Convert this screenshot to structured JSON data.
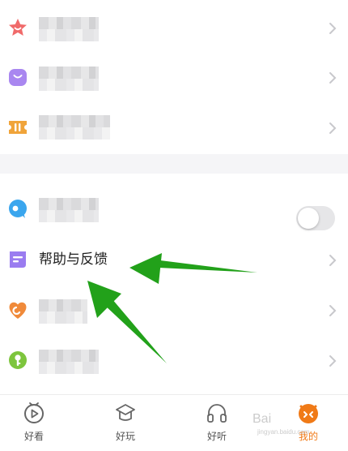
{
  "menu": {
    "help_feedback_label": "帮助与反馈"
  },
  "toggle": {
    "on": false
  },
  "tabbar": {
    "tabs": [
      {
        "label": "好看",
        "icon": "play-circle-icon",
        "active": false
      },
      {
        "label": "好玩",
        "icon": "cap-icon",
        "active": false
      },
      {
        "label": "好听",
        "icon": "headphones-icon",
        "active": false
      },
      {
        "label": "我的",
        "icon": "mascot-icon",
        "active": true
      }
    ]
  },
  "watermark": {
    "text": "Bai",
    "sub": "jingyan.baidu.com"
  },
  "colors": {
    "accent": "#f07a17",
    "arrow": "#22a11a",
    "background": "#f5f5f7"
  }
}
